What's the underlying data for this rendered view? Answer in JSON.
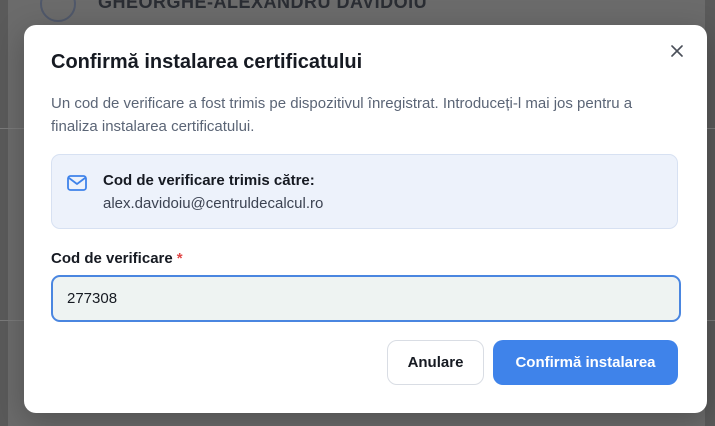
{
  "background": {
    "name_text": "GHEORGHE-ALEXANDRU DAVIDOIU"
  },
  "dialog": {
    "title": "Confirmă instalarea certificatului",
    "description": "Un cod de verificare a fost trimis pe dispozitivul înregistrat. Introduceți-l mai jos pentru a finaliza instalarea certificatului.",
    "info": {
      "icon": "mail-icon",
      "label": "Cod de verificare trimis către:",
      "email": "alex.davidoiu@centruldecalcul.ro"
    },
    "field": {
      "label": "Cod de verificare",
      "required_mark": "*",
      "value": "277308"
    },
    "buttons": {
      "cancel": "Anulare",
      "confirm": "Confirmă instalarea"
    },
    "close_icon": "close-icon"
  },
  "colors": {
    "accent": "#3f83ea",
    "info_bg": "#edf2fb",
    "required": "#e04646"
  }
}
